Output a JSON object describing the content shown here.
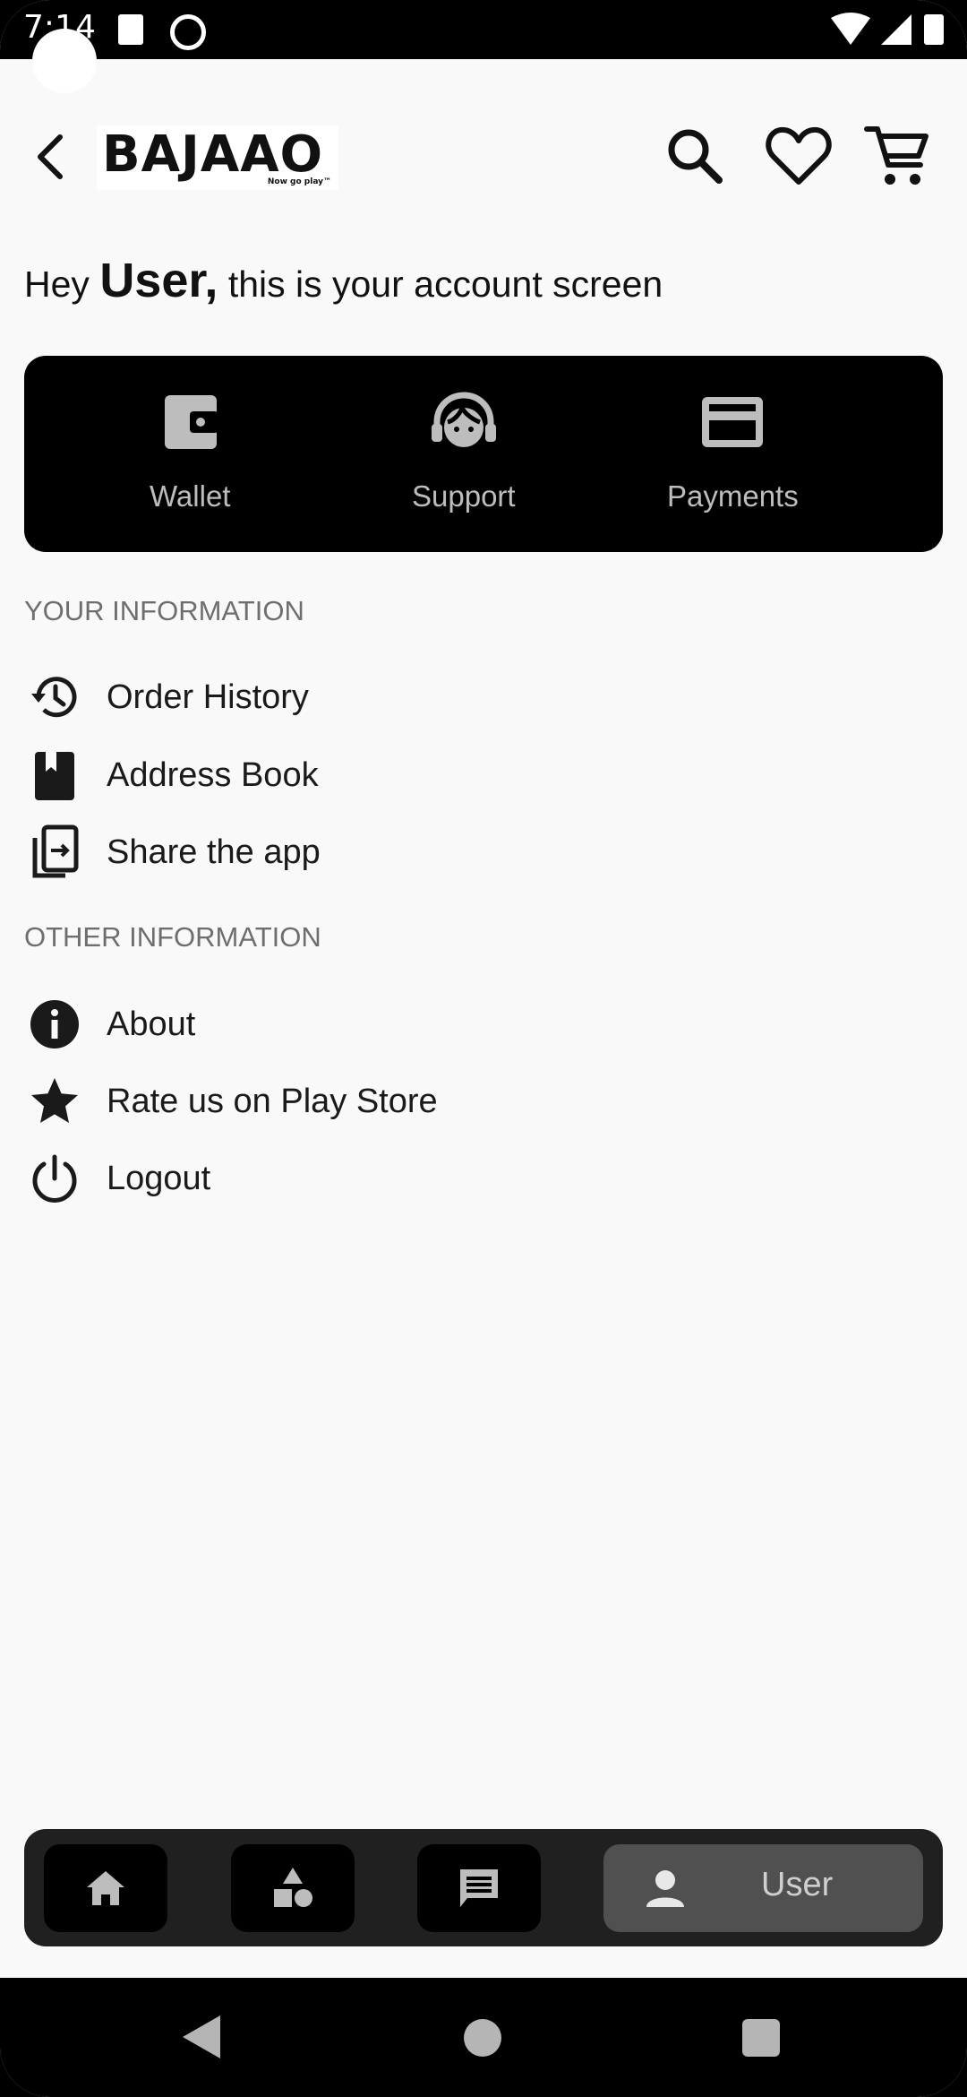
{
  "status_bar": {
    "time": "7:14"
  },
  "header": {
    "brand": "BAJAAO",
    "tagline": "Now go play™"
  },
  "greeting": {
    "prefix": "Hey ",
    "name": "User,",
    "suffix": " this is your account screen"
  },
  "quick_actions": [
    {
      "label": "Wallet",
      "icon": "wallet-icon"
    },
    {
      "label": "Support",
      "icon": "headset-icon"
    },
    {
      "label": "Payments",
      "icon": "credit-card-icon"
    }
  ],
  "sections": {
    "your_information": {
      "title": "YOUR INFORMATION",
      "items": [
        {
          "label": "Order History",
          "icon": "history-icon"
        },
        {
          "label": "Address Book",
          "icon": "address-book-icon"
        },
        {
          "label": "Share the app",
          "icon": "share-icon"
        }
      ]
    },
    "other_information": {
      "title": "OTHER INFORMATION",
      "items": [
        {
          "label": "About",
          "icon": "info-icon"
        },
        {
          "label": "Rate us on Play Store",
          "icon": "star-icon"
        },
        {
          "label": "Logout",
          "icon": "power-icon"
        }
      ]
    }
  },
  "bottom_nav": {
    "items": [
      {
        "icon": "home-icon"
      },
      {
        "icon": "categories-icon"
      },
      {
        "icon": "chat-icon"
      }
    ],
    "active": {
      "label": "User",
      "icon": "user-icon"
    }
  },
  "colors": {
    "background": "#f9f9f9",
    "card": "#000000",
    "nav_active": "#505050"
  }
}
